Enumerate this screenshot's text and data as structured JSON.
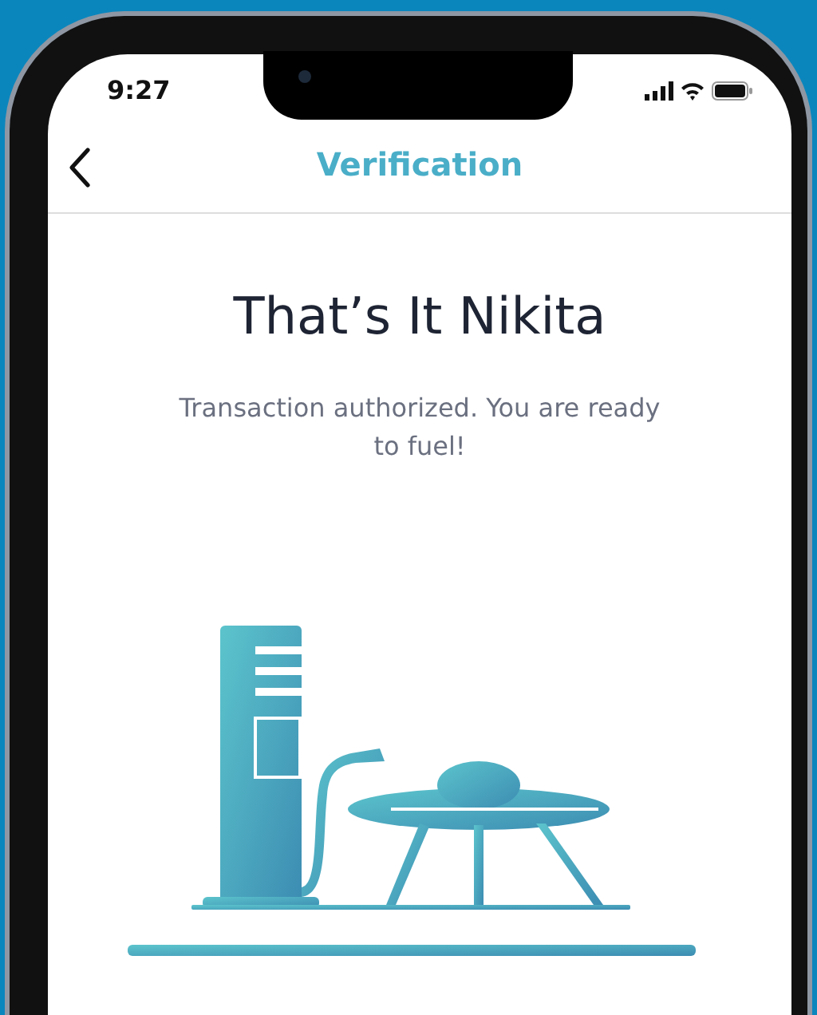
{
  "status_bar": {
    "time": "9:27"
  },
  "nav": {
    "title": "Verification"
  },
  "heading": "That’s It Nikita",
  "message": "Transaction authorized. You are ready to fuel!"
}
